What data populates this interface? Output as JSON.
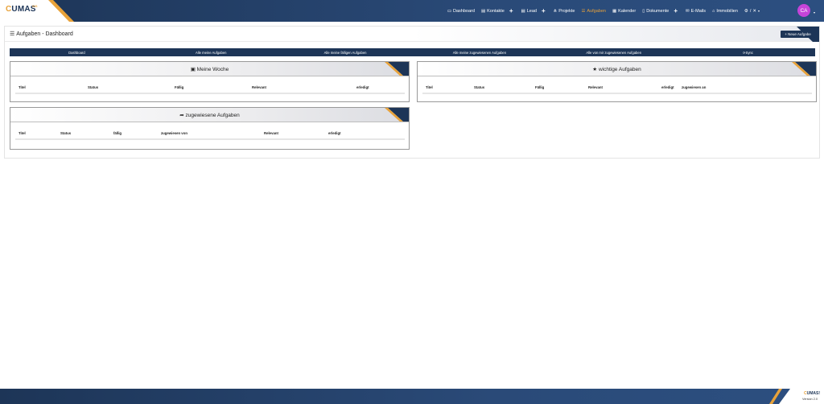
{
  "brand": {
    "logo_o": "C",
    "logo_rest": "UMAS",
    "logo_sub": "GIS"
  },
  "nav": {
    "dashboard": "Dashboard",
    "kontakte": "Kontakte",
    "lead": "Lead",
    "projekte": "Projekte",
    "aufgaben": "Aufgaben",
    "kalender": "Kalender",
    "dokumente": "Dokumente",
    "emails": "E-Mails",
    "immobilien": "Immobilien",
    "settings_caret": "▾",
    "plus": "+"
  },
  "user": {
    "initials": "CA"
  },
  "page": {
    "title": "Aufgaben - Dashboard",
    "new_button": "+ Neue Aufgabe"
  },
  "tabs": [
    "Dashboard",
    "Alle meine Aufgaben",
    "Alle meine fälligen Aufgaben",
    "Alle meine zugewiesenen Aufgaben",
    "Alle von mir zugewiesenen Aufgaben",
    "Sync"
  ],
  "cards": {
    "meine_woche": {
      "title": "Meine Woche",
      "columns": [
        "Titel",
        "Status",
        "Fällig",
        "Relevant",
        "erledigt"
      ]
    },
    "wichtige": {
      "title": "wichtige Aufgaben",
      "columns": [
        "Titel",
        "Status",
        "Fällig",
        "Relevant",
        "erledigt",
        "zugewiesen an"
      ]
    },
    "zugewiesene": {
      "title": "zugewiesene Aufgaben",
      "columns": [
        "Titel",
        "Status",
        "fällig",
        "zugewiesen von",
        "Relevant",
        "erledigt"
      ]
    }
  },
  "footer": {
    "logo_o": "C",
    "logo_rest": "UMAS!",
    "version": "Version 2.0"
  },
  "colors": {
    "primary": "#1d3557",
    "accent": "#e8a23a",
    "avatar": "#c544d9"
  }
}
